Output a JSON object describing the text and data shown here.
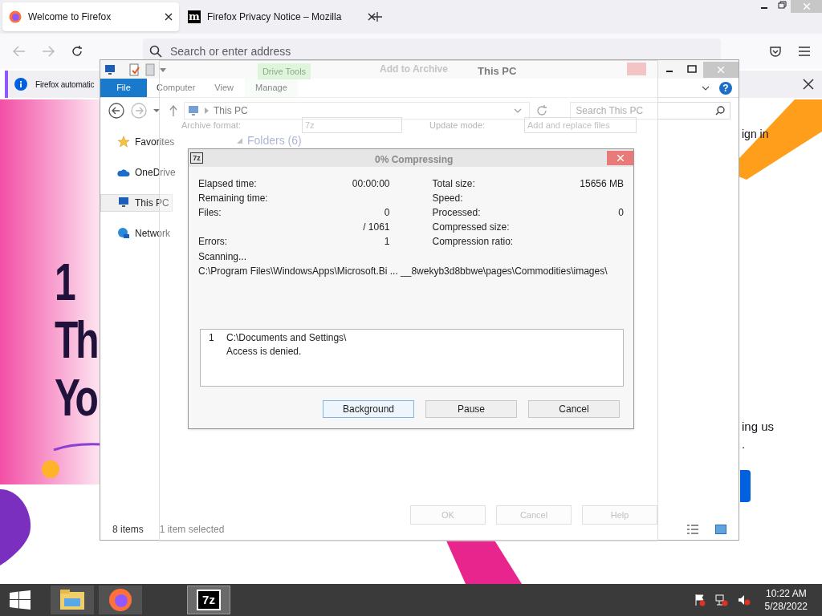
{
  "browser": {
    "tabs": [
      {
        "title": "Welcome to Firefox",
        "selected": true
      },
      {
        "title": "Firefox Privacy Notice – Mozilla",
        "logo": "m",
        "selected": false
      }
    ],
    "address": {
      "placeholder": "Search or enter address"
    },
    "notification": "Firefox automatic",
    "page": {
      "heading_lines": [
        "1",
        "Th",
        "Yo"
      ],
      "sign_in": "ign in",
      "fragments": [
        "ing us",
        "."
      ]
    }
  },
  "explorer": {
    "title": "This PC",
    "context_group": "Drive Tools",
    "ribbon_tabs": [
      {
        "label": "File",
        "kind": "file"
      },
      {
        "label": "Computer",
        "kind": "tab"
      },
      {
        "label": "View",
        "kind": "tab"
      },
      {
        "label": "Manage",
        "kind": "context"
      }
    ],
    "help": "?",
    "path": "This PC",
    "search": {
      "placeholder": "Search This PC"
    },
    "nav": [
      {
        "label": "Favorites",
        "selected": false
      },
      {
        "label": "OneDrive",
        "selected": false
      },
      {
        "label": "This PC",
        "selected": true
      },
      {
        "label": "Network",
        "selected": false
      }
    ],
    "section": "Folders (6)",
    "status": {
      "count": "8 items",
      "selection": "1 item selected"
    }
  },
  "archive_dialog": {
    "title": "Add to Archive",
    "fields": [
      {
        "label": "Archive format:",
        "value": "7z"
      },
      {
        "label": "Update mode:",
        "value": "Add and replace files"
      }
    ],
    "buttons": [
      "OK",
      "Cancel",
      "Help"
    ]
  },
  "progress_dialog": {
    "logo": "7z",
    "title": "0% Compressing",
    "left": [
      {
        "label": "Elapsed time:",
        "value": "00:00:00"
      },
      {
        "label": "Remaining time:"
      },
      {
        "label": "Files:",
        "value": "0"
      },
      {
        "value": "/ 1061"
      },
      {
        "label": "Errors:",
        "value": "1"
      }
    ],
    "right": [
      {
        "label": "Total size:",
        "value": "15656 MB"
      },
      {
        "label": "Speed:"
      },
      {
        "label": "Processed:",
        "value": "0"
      },
      {
        "label": "Compressed size:"
      },
      {
        "label": "Compression ratio:"
      }
    ],
    "state": "Scanning...",
    "current_path": "C:\\Program Files\\WindowsApps\\Microsoft.Bi ... __8wekyb3d8bbwe\\pages\\Commodities\\images\\",
    "errors": [
      {
        "index": "1",
        "path": "C:\\Documents and Settings\\",
        "message": "Access is denied."
      }
    ],
    "buttons": [
      {
        "label": "Background",
        "focused": true
      },
      {
        "label": "Pause",
        "focused": false
      },
      {
        "label": "Cancel",
        "focused": false
      }
    ]
  },
  "taskbar": {
    "apps": [
      {
        "kind": "explorer",
        "active": false
      },
      {
        "kind": "firefox",
        "active": false
      },
      {
        "kind": "sevenzip",
        "label": "7z",
        "active": true
      }
    ],
    "time": "10:22 AM",
    "date": "5/28/2022"
  }
}
